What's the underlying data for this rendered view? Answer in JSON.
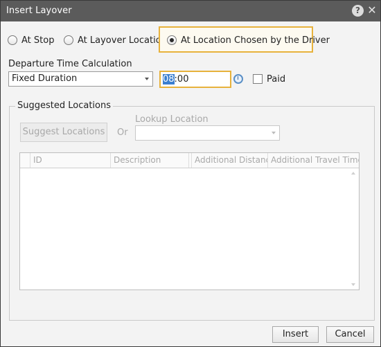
{
  "window": {
    "title": "Insert Layover",
    "help_glyph": "?",
    "close_glyph": "✕"
  },
  "location_mode": {
    "options": [
      {
        "label": "At Stop",
        "selected": false
      },
      {
        "label": "At Layover Location",
        "selected": false
      },
      {
        "label": "At Location Chosen by the Driver",
        "selected": true
      }
    ]
  },
  "departure": {
    "label": "Departure Time Calculation",
    "method_value": "Fixed Duration",
    "time_selected_part": "08",
    "time_rest": ":00",
    "paid_label": "Paid",
    "paid_checked": false
  },
  "suggested": {
    "group_label": "Suggested Locations",
    "suggest_button": "Suggest Locations",
    "or_label": "Or",
    "lookup_label": "Lookup Location",
    "lookup_value": ""
  },
  "grid": {
    "columns": [
      "ID",
      "Description",
      "Additional Distance",
      "Additional Travel Time"
    ],
    "rows": []
  },
  "footer": {
    "insert_label": "Insert",
    "cancel_label": "Cancel"
  },
  "colors": {
    "titlebar": "#5b5b5b",
    "focus_accent": "#e7b23c",
    "selection": "#3b7fd0"
  }
}
